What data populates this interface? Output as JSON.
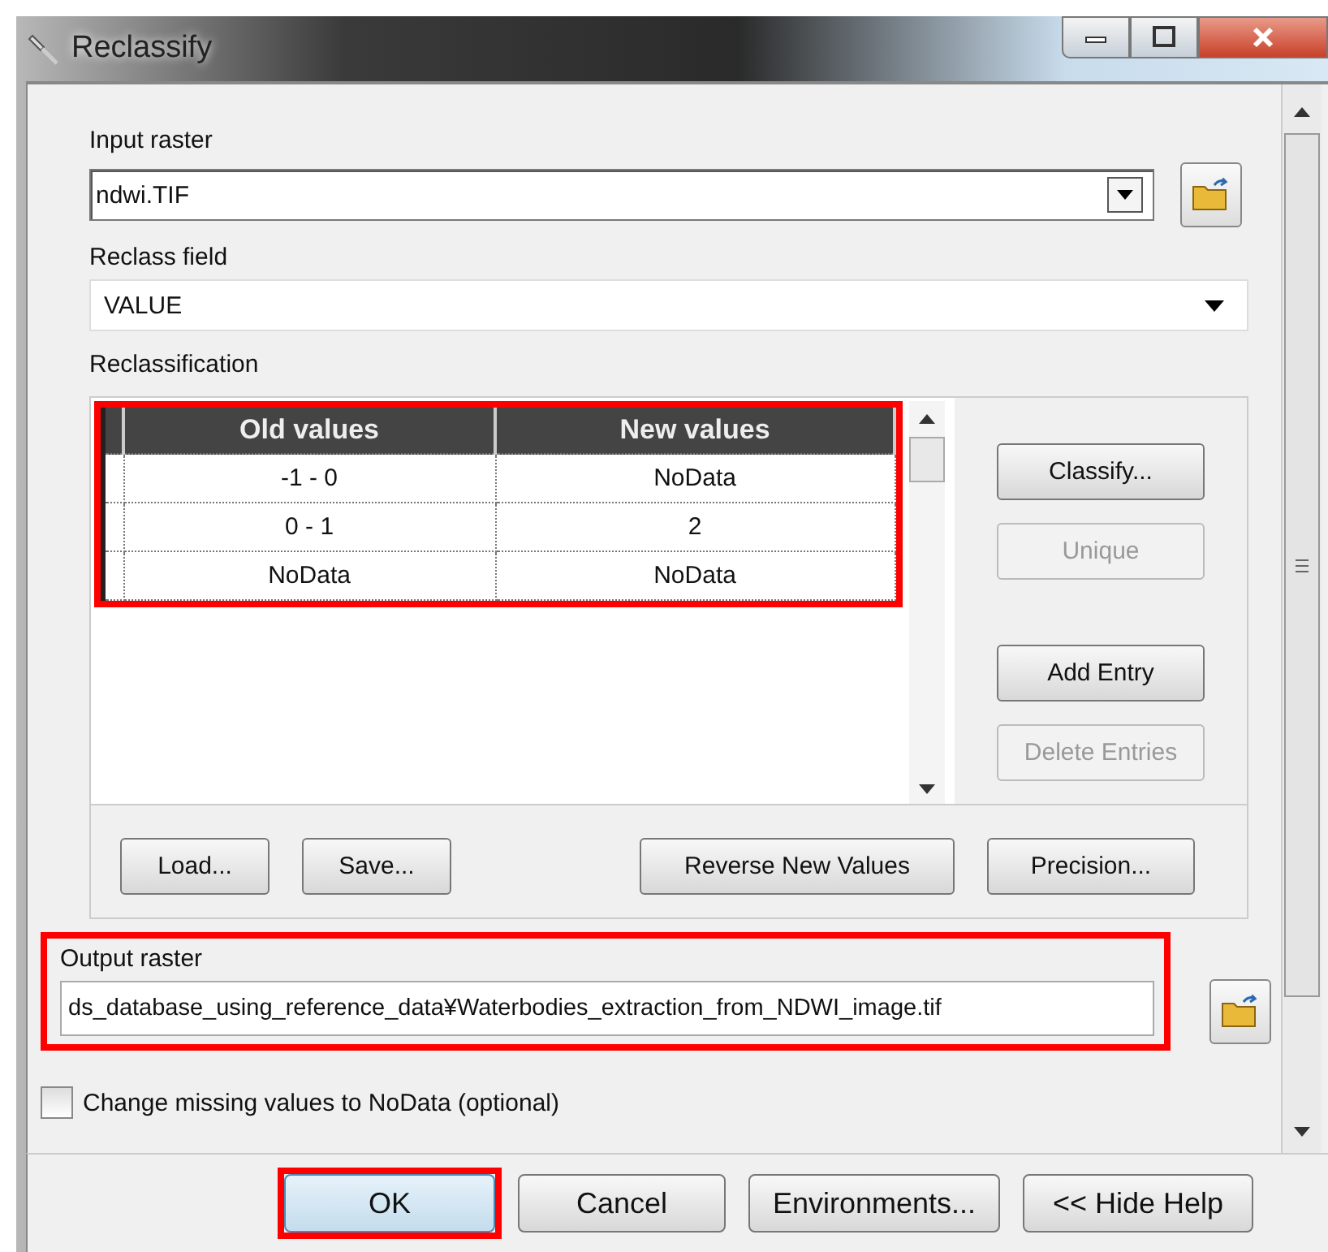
{
  "window": {
    "title": "Reclassify"
  },
  "input_raster": {
    "label": "Input raster",
    "value": "ndwi.TIF"
  },
  "reclass_field": {
    "label": "Reclass field",
    "value": "VALUE"
  },
  "reclassification": {
    "label": "Reclassification",
    "highlighted": true,
    "columns": [
      "Old values",
      "New values"
    ],
    "rows": [
      {
        "old": "-1 - 0",
        "new": "NoData"
      },
      {
        "old": "0 - 1",
        "new": "2"
      },
      {
        "old": "NoData",
        "new": "NoData"
      }
    ],
    "side_buttons": [
      {
        "label": "Classify...",
        "disabled": false
      },
      {
        "label": "Unique",
        "disabled": true
      },
      {
        "label": "Add Entry",
        "disabled": false
      },
      {
        "label": "Delete Entries",
        "disabled": true
      }
    ],
    "bottom_buttons": [
      {
        "label": "Load..."
      },
      {
        "label": "Save..."
      },
      {
        "label": "Reverse New Values"
      },
      {
        "label": "Precision..."
      }
    ]
  },
  "output_raster": {
    "label": "Output raster",
    "value": "ds_database_using_reference_data¥Waterbodies_extraction_from_NDWI_image.tif",
    "highlighted": true
  },
  "missing_values": {
    "label": "Change missing values to NoData (optional)",
    "checked": false
  },
  "buttons": [
    {
      "label": "OK",
      "highlighted": true
    },
    {
      "label": "Cancel",
      "highlighted": false
    },
    {
      "label": "Environments...",
      "highlighted": false
    },
    {
      "label": "<< Hide Help",
      "highlighted": false
    }
  ]
}
